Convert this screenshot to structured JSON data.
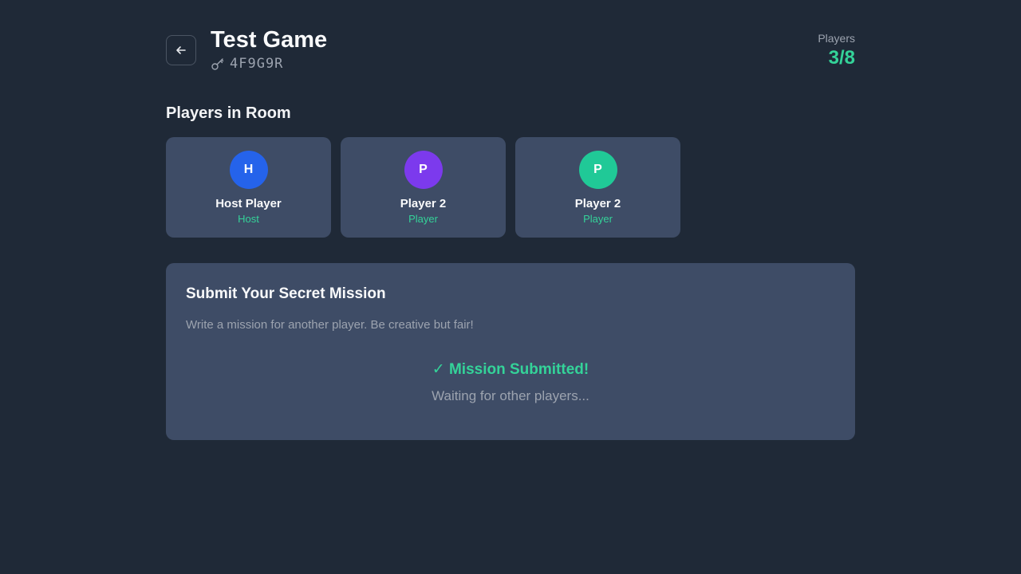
{
  "header": {
    "title": "Test Game",
    "room_code": "4F9G9R",
    "players_label": "Players",
    "players_value": "3/8"
  },
  "icons": {
    "back": "arrow-left-icon",
    "key": "key-icon"
  },
  "players_section": {
    "title": "Players in Room",
    "players": [
      {
        "initial": "H",
        "name": "Host Player",
        "role": "Host",
        "color": "#2563eb"
      },
      {
        "initial": "P",
        "name": "Player 2",
        "role": "Player",
        "color": "#7c3aed"
      },
      {
        "initial": "P",
        "name": "Player 2",
        "role": "Player",
        "color": "#20c997"
      }
    ]
  },
  "mission": {
    "title": "Submit Your Secret Mission",
    "description": "Write a mission for another player. Be creative but fair!",
    "status_title": "✓ Mission Submitted!",
    "status_subtitle": "Waiting for other players..."
  },
  "colors": {
    "background": "#1f2937",
    "card": "#3e4c66",
    "accent": "#34d399",
    "muted_text": "#9ca3af"
  }
}
